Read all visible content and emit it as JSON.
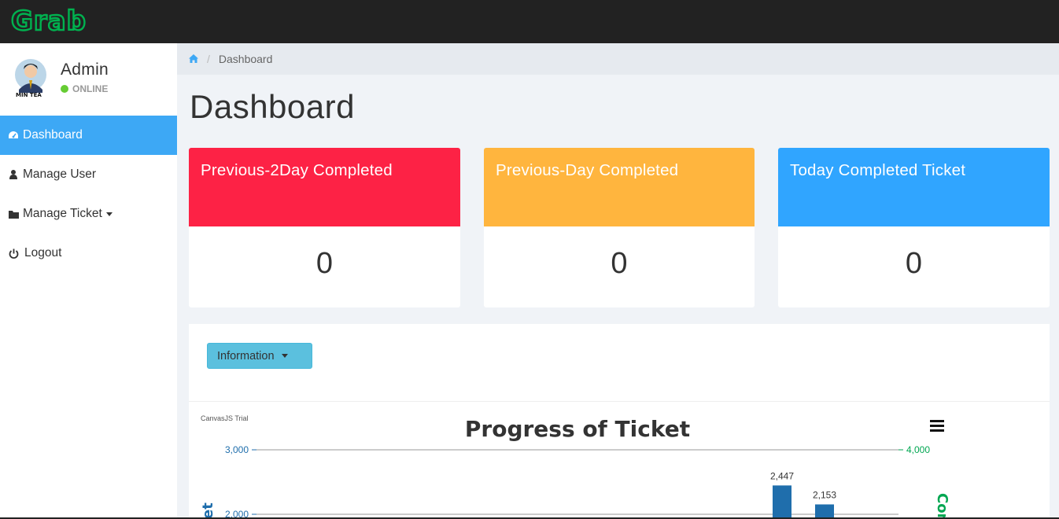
{
  "topbar": {
    "logo_text": "Grab",
    "logo_color": "#00b14f",
    "bg_color": "#222222"
  },
  "sidebar": {
    "profile": {
      "name": "Admin",
      "status": "ONLINE",
      "status_color": "#66cc33"
    },
    "items": [
      {
        "label": "Dashboard",
        "icon": "tachometer-icon",
        "active": true
      },
      {
        "label": "Manage User",
        "icon": "user-icon",
        "active": false
      },
      {
        "label": "Manage Ticket",
        "icon": "folder-icon",
        "active": false,
        "has_dropdown": true
      },
      {
        "label": "Logout",
        "icon": "power-icon",
        "active": false
      }
    ],
    "active_color": "#3da8f5"
  },
  "breadcrumb": {
    "home_icon": "home-icon",
    "current": "Dashboard"
  },
  "page": {
    "title": "Dashboard"
  },
  "stats": [
    {
      "title": "Previous-2Day Completed",
      "value": "0",
      "color": "#fd2245"
    },
    {
      "title": "Previous-Day Completed",
      "value": "0",
      "color": "#ffb53e"
    },
    {
      "title": "Today Completed Ticket",
      "value": "0",
      "color": "#30a5ff"
    }
  ],
  "panel": {
    "dropdown_label": "Information"
  },
  "chart_data": {
    "type": "bar",
    "title": "Progress of Ticket",
    "watermark": "CanvasJS Trial",
    "menu_icon": "hamburger-icon",
    "y_ticks": [
      "3,000",
      "2,000"
    ],
    "y2_ticks": [
      "4,000"
    ],
    "ylim": [
      2000,
      3000
    ],
    "y2_max": 4000,
    "y_axis_color": "#1f6eac",
    "y2_axis_color": "#00a651",
    "y2_label_partial": "Com",
    "y_label_partial": "et",
    "series": [
      {
        "values": [
          2447,
          2153
        ],
        "data_labels": [
          "2,447",
          "2,153"
        ],
        "color": "#1f6eac"
      }
    ]
  }
}
